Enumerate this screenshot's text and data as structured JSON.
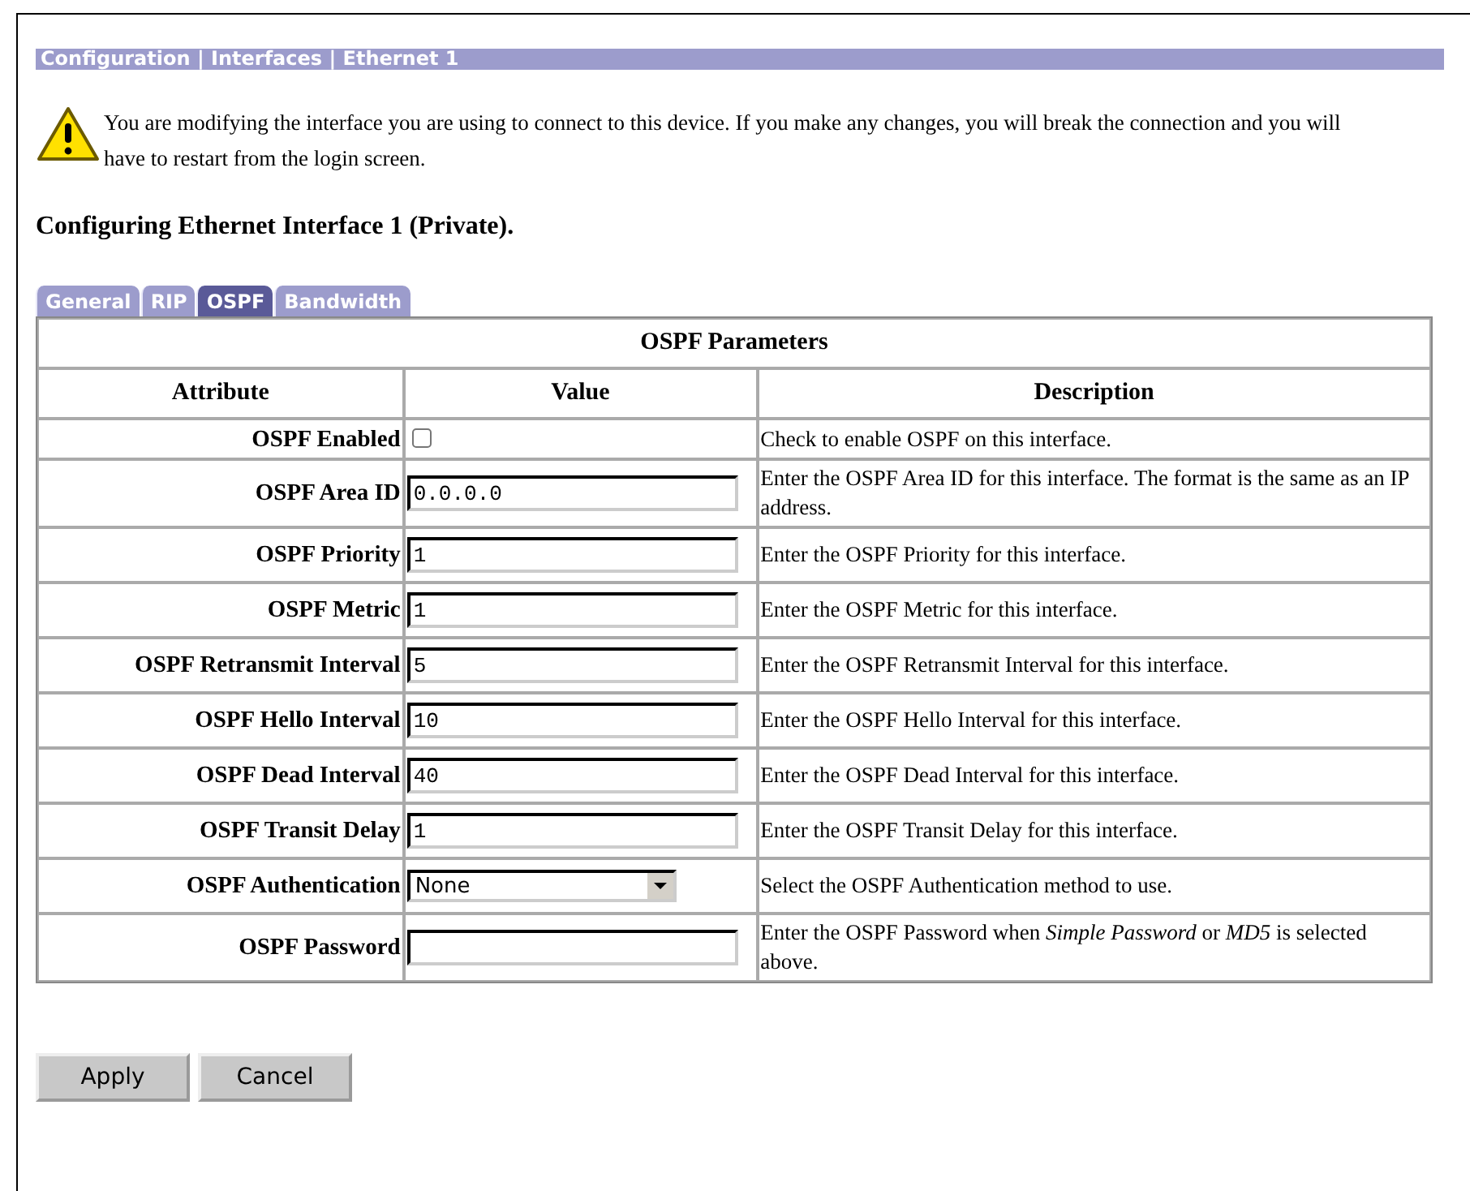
{
  "breadcrumb": "Configuration | Interfaces | Ethernet 1",
  "warning": "You are modifying the interface you are using to connect to this device. If you make any changes, you will break the connection and you will have to restart from the login screen.",
  "heading": "Configuring Ethernet Interface 1 (Private).",
  "tabs": [
    {
      "label": "General",
      "selected": false
    },
    {
      "label": "RIP",
      "selected": false
    },
    {
      "label": "OSPF",
      "selected": true
    },
    {
      "label": "Bandwidth",
      "selected": false
    }
  ],
  "table": {
    "title": "OSPF Parameters",
    "columns": [
      "Attribute",
      "Value",
      "Description"
    ],
    "rows": [
      {
        "kind": "checkbox",
        "attribute": "OSPF Enabled",
        "checked": false,
        "description": "Check to enable OSPF on this interface."
      },
      {
        "kind": "text",
        "attribute": "OSPF Area ID",
        "value": "0.0.0.0",
        "description": "Enter the OSPF Area ID for this interface. The format is the same as an IP address."
      },
      {
        "kind": "text",
        "attribute": "OSPF Priority",
        "value": "1",
        "description": "Enter the OSPF Priority for this interface."
      },
      {
        "kind": "text",
        "attribute": "OSPF Metric",
        "value": "1",
        "description": "Enter the OSPF Metric for this interface."
      },
      {
        "kind": "text",
        "attribute": "OSPF Retransmit Interval",
        "value": "5",
        "description": "Enter the OSPF Retransmit Interval for this interface."
      },
      {
        "kind": "text",
        "attribute": "OSPF Hello Interval",
        "value": "10",
        "description": "Enter the OSPF Hello Interval for this interface."
      },
      {
        "kind": "text",
        "attribute": "OSPF Dead Interval",
        "value": "40",
        "description": "Enter the OSPF Dead Interval for this interface."
      },
      {
        "kind": "text",
        "attribute": "OSPF Transit Delay",
        "value": "1",
        "description": "Enter the OSPF Transit Delay for this interface."
      },
      {
        "kind": "select",
        "attribute": "OSPF Authentication",
        "value": "None",
        "description": "Select the OSPF Authentication method to use."
      },
      {
        "kind": "text",
        "attribute": "OSPF Password",
        "description": "Enter the OSPF Password when *Simple Password* or *MD5* is selected above."
      }
    ]
  },
  "buttons": [
    "Apply",
    "Cancel"
  ]
}
